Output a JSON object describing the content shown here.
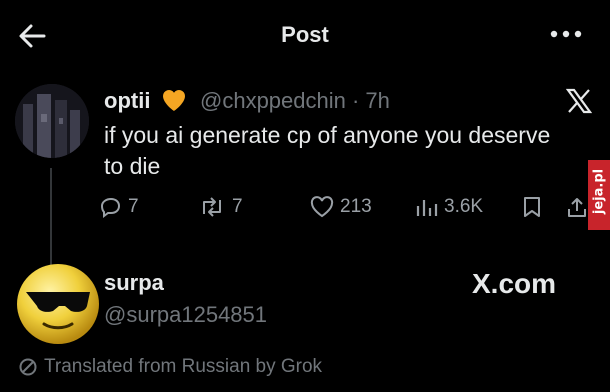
{
  "header": {
    "title": "Post"
  },
  "post": {
    "display_name": "optii",
    "handle_time": "@chxppedchin · 7h",
    "text": "if you ai generate cp of anyone you deserve to die",
    "replies": "7",
    "reposts": "7",
    "likes": "213",
    "views": "3.6K"
  },
  "reply": {
    "display_name": "surpa",
    "handle": "@surpa1254851"
  },
  "watermark": "jeja.pl",
  "xcom_label": "X.com",
  "translated_note": "Translated from Russian by Grok",
  "colors": {
    "background": "#000000",
    "text": "#e7e9ea",
    "muted": "#71767b",
    "heart": "#f5a623",
    "watermark": "#c8242b"
  }
}
